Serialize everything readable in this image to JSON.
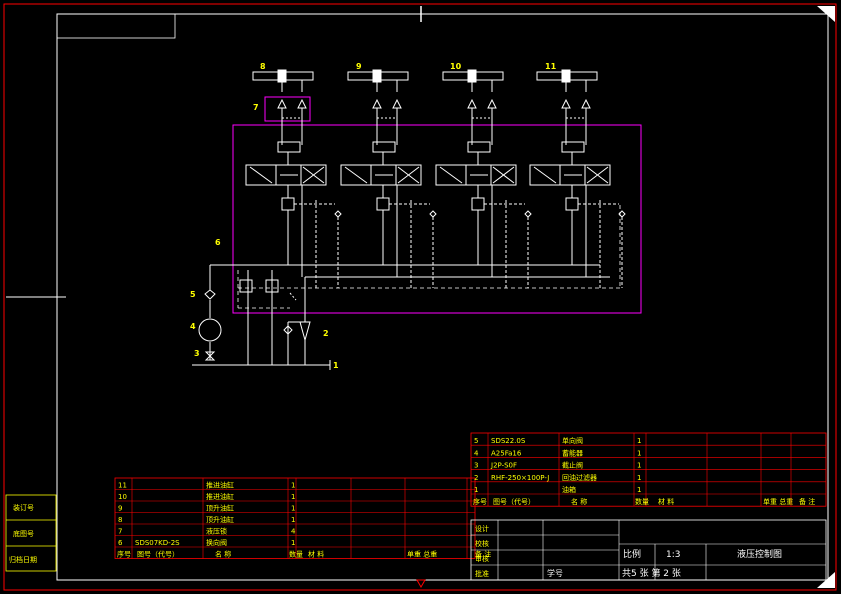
{
  "callouts": {
    "c1": "1",
    "c2": "2",
    "c3": "3",
    "c4": "4",
    "c5": "5",
    "c6": "6",
    "c7": "7",
    "c8": "8",
    "c9": "9",
    "c10": "10",
    "c11": "11"
  },
  "left_strip": {
    "l1": "装订号",
    "l2": "底图号",
    "l3": "归档日期"
  },
  "left_table": {
    "rows": [
      {
        "no": "11",
        "code": "",
        "name": "推进油缸",
        "qty": "1"
      },
      {
        "no": "10",
        "code": "",
        "name": "推进油缸",
        "qty": "1"
      },
      {
        "no": "9",
        "code": "",
        "name": "顶升油缸",
        "qty": "1"
      },
      {
        "no": "8",
        "code": "",
        "name": "顶升油缸",
        "qty": "1"
      },
      {
        "no": "7",
        "code": "",
        "name": "液压锁",
        "qty": "4"
      },
      {
        "no": "6",
        "code": "SDS07KD-2S",
        "name": "换向阀",
        "qty": "1"
      }
    ],
    "header": {
      "no": "序号",
      "code": "图号（代号）",
      "name": "名 称",
      "qty": "数量",
      "mat": "材 料",
      "w": "单重 总重",
      "rem": "备 注"
    }
  },
  "right_table": {
    "rows": [
      {
        "no": "5",
        "code": "SDS22.0S",
        "name": "单向阀",
        "qty": "1"
      },
      {
        "no": "4",
        "code": "A25Fa16",
        "name": "蓄能器",
        "qty": "1"
      },
      {
        "no": "3",
        "code": "J2P-S0F",
        "name": "截止阀",
        "qty": "1"
      },
      {
        "no": "2",
        "code": "RHF-250×100P-J",
        "name": "回油过滤器",
        "qty": "1"
      },
      {
        "no": "1",
        "code": "",
        "name": "油箱",
        "qty": "1"
      }
    ],
    "header": {
      "no": "序号",
      "code": "图号（代号）",
      "name": "名 称",
      "qty": "数量",
      "mat": "材 料",
      "w": "单重 总重",
      "rem": "备 注"
    }
  },
  "title_block": {
    "design": "设计",
    "check": "校核",
    "review": "审核",
    "approve": "批准",
    "scale_label": "比例",
    "scale": "1:3",
    "title": "液压控制图",
    "sheets": "共5 张 第 2 张",
    "school": "学号"
  }
}
